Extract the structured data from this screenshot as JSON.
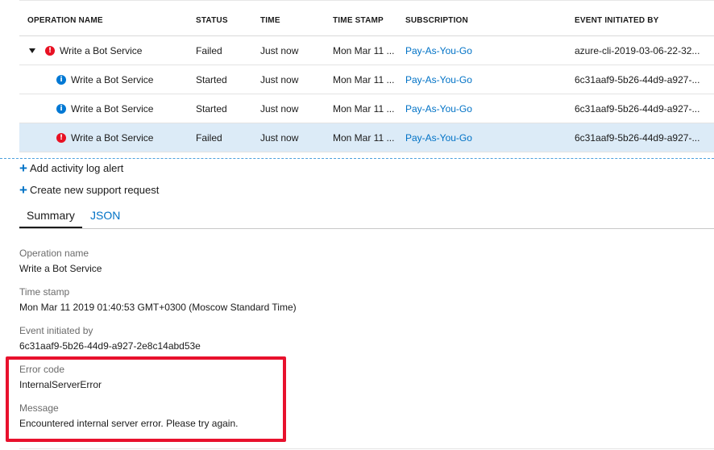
{
  "table": {
    "columns": [
      "OPERATION NAME",
      "STATUS",
      "TIME",
      "TIME STAMP",
      "SUBSCRIPTION",
      "EVENT INITIATED BY"
    ],
    "rows": [
      {
        "operation": "Write a Bot Service",
        "status": "Failed",
        "time": "Just now",
        "timestamp": "Mon Mar 11 ...",
        "subscription": "Pay-As-You-Go",
        "initiated_by": "azure-cli-2019-03-06-22-32...",
        "icon": "error-icon",
        "expandable": true
      },
      {
        "operation": "Write a Bot Service",
        "status": "Started",
        "time": "Just now",
        "timestamp": "Mon Mar 11 ...",
        "subscription": "Pay-As-You-Go",
        "initiated_by": "6c31aaf9-5b26-44d9-a927-...",
        "icon": "info-icon",
        "expandable": false
      },
      {
        "operation": "Write a Bot Service",
        "status": "Started",
        "time": "Just now",
        "timestamp": "Mon Mar 11 ...",
        "subscription": "Pay-As-You-Go",
        "initiated_by": "6c31aaf9-5b26-44d9-a927-...",
        "icon": "info-icon",
        "expandable": false
      },
      {
        "operation": "Write a Bot Service",
        "status": "Failed",
        "time": "Just now",
        "timestamp": "Mon Mar 11 ...",
        "subscription": "Pay-As-You-Go",
        "initiated_by": "6c31aaf9-5b26-44d9-a927-...",
        "icon": "error-icon",
        "expandable": false,
        "selected": true
      }
    ]
  },
  "actions": {
    "add_alert": "Add activity log alert",
    "support_request": "Create new support request"
  },
  "tabs": {
    "summary": "Summary",
    "json": "JSON"
  },
  "details": {
    "operation_name_label": "Operation name",
    "operation_name_value": "Write a Bot Service",
    "timestamp_label": "Time stamp",
    "timestamp_value": "Mon Mar 11 2019 01:40:53 GMT+0300 (Moscow Standard Time)",
    "initiated_label": "Event initiated by",
    "initiated_value": "6c31aaf9-5b26-44d9-a927-2e8c14abd53e",
    "error_code_label": "Error code",
    "error_code_value": "InternalServerError",
    "message_label": "Message",
    "message_value": "Encountered internal server error. Please try again."
  },
  "colors": {
    "accent": "#0072c6",
    "error": "#e81123",
    "info": "#0078d4",
    "selected_row": "#dcebf7",
    "highlight_box": "#e8112d"
  }
}
